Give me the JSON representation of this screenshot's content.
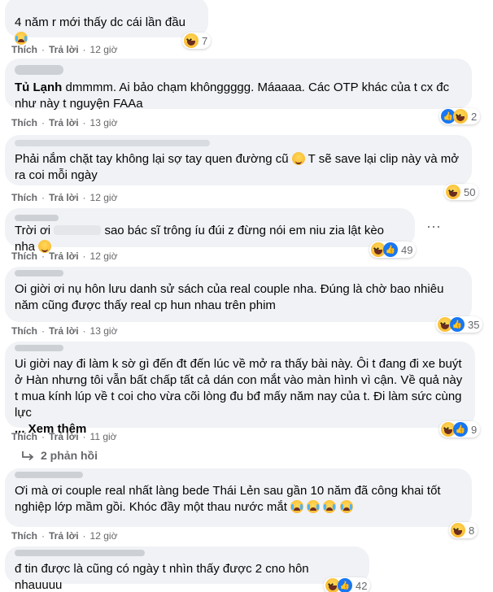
{
  "comments": [
    {
      "text": "4 năm r mới thấy dc cái lần đầu",
      "reaction_count": "7"
    },
    {
      "actions": {
        "like": "Thích",
        "reply": "Trả lời",
        "time": "12 giờ"
      },
      "tag": "Tủ Lạnh",
      "text": "dmmmm. Ai bảo chạm khônggggg. Máaaaa. Các OTP khác của t cx đc như này t nguyện FAAa",
      "reaction_count": "2"
    },
    {
      "actions": {
        "like": "Thích",
        "reply": "Trả lời",
        "time": "13 giờ"
      },
      "text": "Phải nắm chặt tay không lại sợ tay quen đường cũ",
      "text2": "T sẽ save lại clip này và mở ra coi mỗi ngày",
      "reaction_count": "50"
    },
    {
      "actions": {
        "like": "Thích",
        "reply": "Trả lời",
        "time": "12 giờ"
      },
      "text_a": "Trời ơi",
      "text_b": "sao bác sĩ trông íu đúi z đừng nói em niu zia lật kèo nha",
      "reaction_count": "49",
      "menu": "···"
    },
    {
      "actions": {
        "like": "Thích",
        "reply": "Trả lời",
        "time": "12 giờ"
      },
      "text": "Oi giời ơi nụ hôn lưu danh sử sách của real couple nha. Đúng là chờ bao nhiêu năm cũng được thấy real cp hun nhau trên phim",
      "reaction_count": "35"
    },
    {
      "actions": {
        "like": "Thích",
        "reply": "Trả lời",
        "time": "13 giờ"
      },
      "text": "Ui giời nay đi làm k sờ gì đến đt đến lúc về mở ra thấy bài này. Ôi t đang đi xe buýt ở Hàn nhưng tôi vẫn bất chấp tất cả dán con mắt vào màn hình vì cận. Về quả này t mua kính lúp về t coi cho vừa cõi lòng đu bđ mấy năm nay của t. Đi làm sức cùng lực",
      "more": "... Xem thêm",
      "reaction_count": "9"
    },
    {
      "actions": {
        "like": "Thích",
        "reply": "Trả lời",
        "time": "11 giờ"
      },
      "replies": "2 phản hồi"
    },
    {
      "text": "Ơi mà ơi couple real nhất làng bede Thái Lẻn sau gần 10 năm đã công khai tốt nghiệp lớp mầm gồi. Khóc đầy một thau nước mắt",
      "reaction_count": "8"
    },
    {
      "actions": {
        "like": "Thích",
        "reply": "Trả lời",
        "time": "12 giờ"
      },
      "text": "đ tin được là cũng có ngày t nhìn thấy được 2 cno hôn nhauuuu",
      "reaction_count": "42"
    }
  ],
  "icons": {
    "haha": "haha-reaction-icon",
    "like": "like-reaction-icon",
    "reply_arrow": "reply-arrow-icon",
    "menu": "more-options-icon"
  },
  "colors": {
    "bubble": "#f0f2f5",
    "meta": "#65676b",
    "like_blue": "#1877f2",
    "haha_yellow": "#f7b125"
  }
}
